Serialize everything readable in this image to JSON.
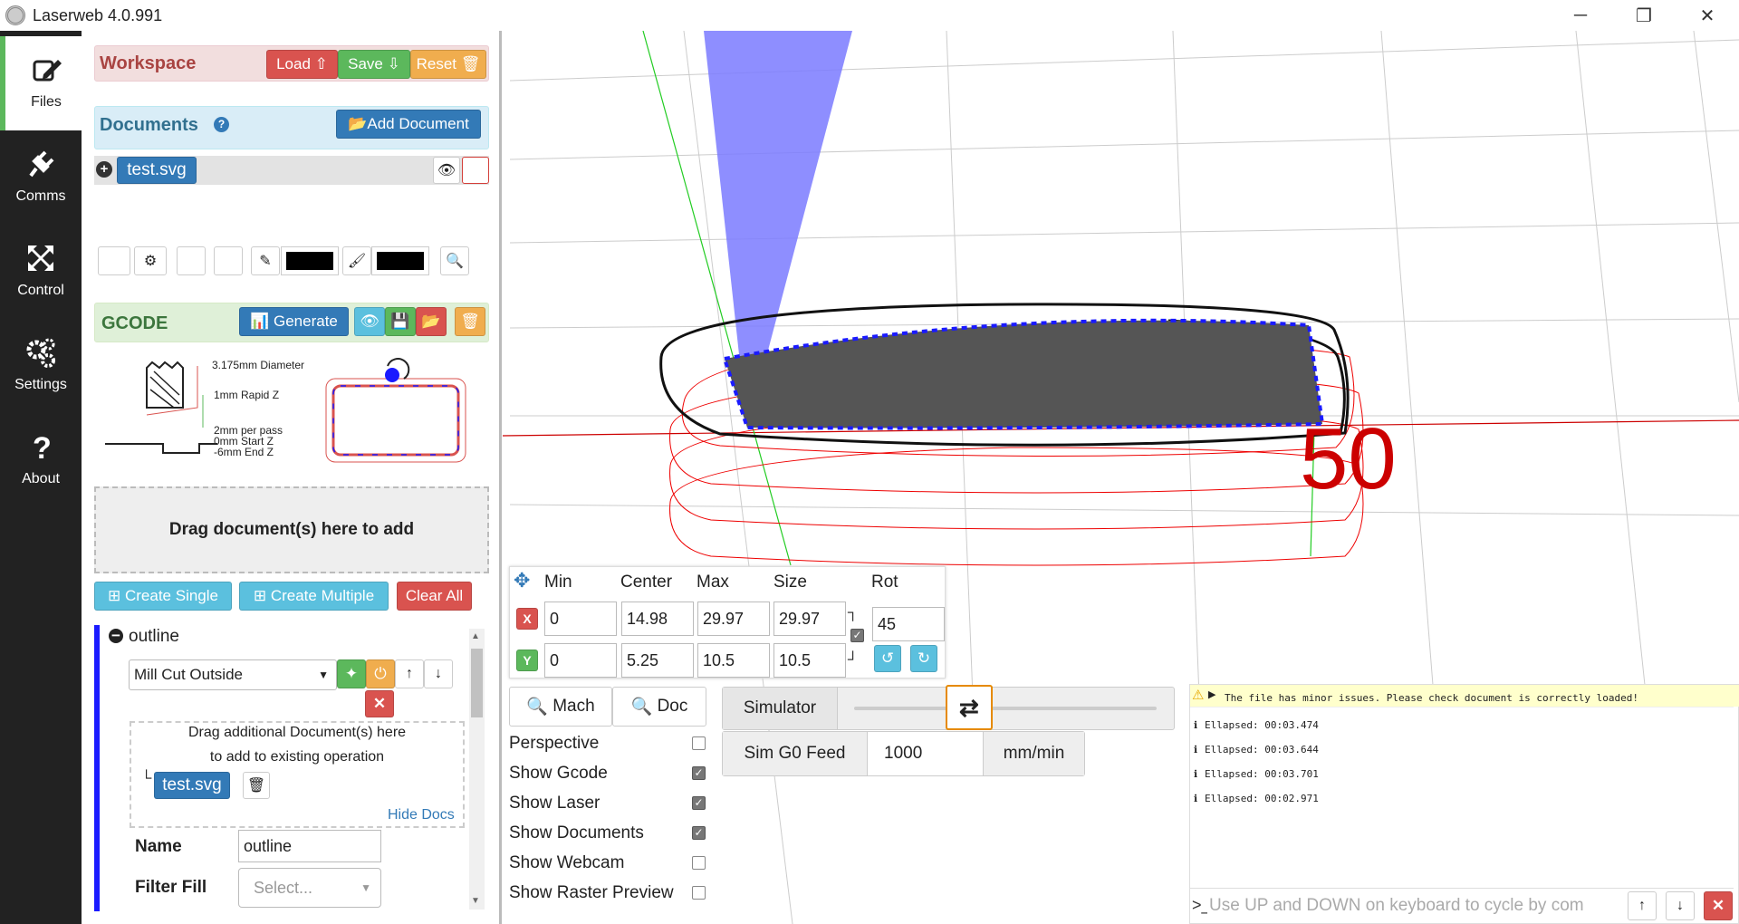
{
  "window": {
    "title": "Laserweb 4.0.991",
    "minimize": "─",
    "restore": "❐",
    "close": "✕"
  },
  "sidebar": [
    {
      "label": "Files",
      "icon": "edit-icon"
    },
    {
      "label": "Comms",
      "icon": "plug-icon"
    },
    {
      "label": "Control",
      "icon": "move-icon"
    },
    {
      "label": "Settings",
      "icon": "gears-icon"
    },
    {
      "label": "About",
      "icon": "question-icon"
    }
  ],
  "workspace": {
    "title": "Workspace",
    "load": "Load",
    "save": "Save",
    "reset": "Reset"
  },
  "documents": {
    "title": "Documents",
    "help": "?",
    "add": "Add Document",
    "items": [
      {
        "name": "test.svg"
      }
    ]
  },
  "toolbar": {
    "stroke_color": "#000000",
    "fill_color": "#000000"
  },
  "gcode": {
    "title": "GCODE",
    "generate": "Generate"
  },
  "diagram": {
    "diameter": "3.175mm Diameter",
    "rapid_z": "1mm Rapid Z",
    "per_pass": "2mm per pass",
    "start_z": "0mm Start Z",
    "end_z": "-6mm End Z"
  },
  "dropzone": "Drag document(s) here to add",
  "actions": {
    "create_single": "Create Single",
    "create_multiple": "Create Multiple",
    "clear_all": "Clear All"
  },
  "operation": {
    "name": "outline",
    "type": "Mill Cut Outside",
    "drag_line1": "Drag additional Document(s) here",
    "drag_line2": "to add to existing operation",
    "doc": "test.svg",
    "hide_docs": "Hide Docs",
    "name_label": "Name",
    "name_value": "outline",
    "filter_label": "Filter Fill",
    "filter_placeholder": "Select..."
  },
  "transform": {
    "headers": [
      "Min",
      "Center",
      "Max",
      "Size",
      "Rot"
    ],
    "x": {
      "label": "X",
      "min": "0",
      "center": "14.98",
      "max": "29.97",
      "size": "29.97"
    },
    "y": {
      "label": "Y",
      "min": "0",
      "center": "5.25",
      "max": "10.5",
      "size": "10.5"
    },
    "rot": "45"
  },
  "view": {
    "mach": "Mach",
    "doc": "Doc"
  },
  "options": [
    {
      "label": "Perspective",
      "checked": false
    },
    {
      "label": "Show Gcode",
      "checked": true
    },
    {
      "label": "Show Laser",
      "checked": true
    },
    {
      "label": "Show Documents",
      "checked": true
    },
    {
      "label": "Show Webcam",
      "checked": false
    },
    {
      "label": "Show Raster Preview",
      "checked": false
    }
  ],
  "simulator": {
    "label": "Simulator",
    "feed_label": "Sim G0 Feed",
    "feed_value": "1000",
    "unit": "mm/min",
    "position": 0.38
  },
  "canvas": {
    "axis_label": "50"
  },
  "console": {
    "warning": "The file has minor issues. Please check document is correctly loaded!",
    "lines": [
      "Ellapsed: 00:03.474",
      "Ellapsed: 00:03.644",
      "Ellapsed: 00:03.701",
      "Ellapsed: 00:02.971"
    ],
    "placeholder": "Use UP and DOWN on keyboard to cycle by com",
    "prompt": ">_"
  },
  "colors": {
    "workspace_bg": "#f2dede",
    "documents_bg": "#d9edf7",
    "gcode_bg": "#dff0d8",
    "op_border": "#1a1aff"
  }
}
